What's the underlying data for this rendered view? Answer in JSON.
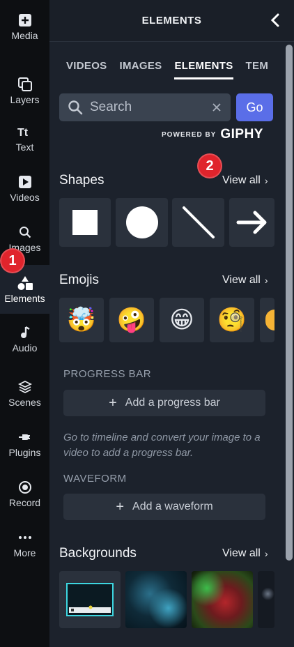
{
  "rail": {
    "items": [
      {
        "label": "Media",
        "icon": "plus-square-icon"
      },
      {
        "label": "Layers",
        "icon": "layers-icon"
      },
      {
        "label": "Text",
        "icon": "text-icon"
      },
      {
        "label": "Videos",
        "icon": "video-icon"
      },
      {
        "label": "Images",
        "icon": "search-icon"
      },
      {
        "label": "Elements",
        "icon": "shapes-icon",
        "active": true
      },
      {
        "label": "Audio",
        "icon": "music-note-icon"
      },
      {
        "label": "Scenes",
        "icon": "stack-icon"
      },
      {
        "label": "Plugins",
        "icon": "plug-icon"
      },
      {
        "label": "Record",
        "icon": "record-icon"
      },
      {
        "label": "More",
        "icon": "ellipsis-icon"
      }
    ]
  },
  "badges": [
    "1",
    "2"
  ],
  "panel": {
    "title": "ELEMENTS",
    "tabs": [
      "VIDEOS",
      "IMAGES",
      "ELEMENTS",
      "TEM"
    ],
    "active_tab": "ELEMENTS",
    "search": {
      "placeholder": "Search",
      "value": "",
      "go_label": "Go"
    },
    "powered_by": "POWERED BY",
    "giphy": "GIPHY",
    "shapes": {
      "title": "Shapes",
      "view_all": "View all",
      "items": [
        "square",
        "circle",
        "line",
        "arrow"
      ]
    },
    "emojis": {
      "title": "Emojis",
      "view_all": "View all",
      "items": [
        "🤯",
        "🤪",
        "😁",
        "🧐"
      ]
    },
    "progress_bar": {
      "label": "PROGRESS BAR",
      "button": "Add a progress bar",
      "hint": "Go to timeline and convert your image to a video to add a progress bar."
    },
    "waveform": {
      "label": "WAVEFORM",
      "button": "Add a waveform"
    },
    "backgrounds": {
      "title": "Backgrounds",
      "view_all": "View all"
    }
  },
  "colors": {
    "accent": "#5a6ee8",
    "badge": "#e0242c",
    "panel_bg": "#1c222c",
    "rail_bg": "#0d0f12"
  }
}
